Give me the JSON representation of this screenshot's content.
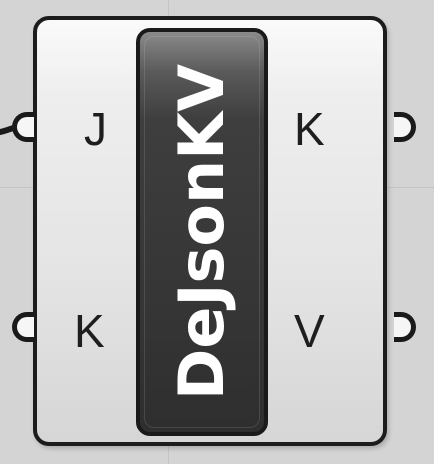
{
  "component": {
    "name": "DeJsonKV",
    "inputs": [
      {
        "label": "J"
      },
      {
        "label": "K"
      }
    ],
    "outputs": [
      {
        "label": "K"
      },
      {
        "label": "V"
      }
    ]
  },
  "colors": {
    "canvas_background": "#d4d4d4",
    "component_body": "#e8e8e8",
    "label_panel": "#3a3a3a",
    "outline": "#1a1a1a"
  }
}
